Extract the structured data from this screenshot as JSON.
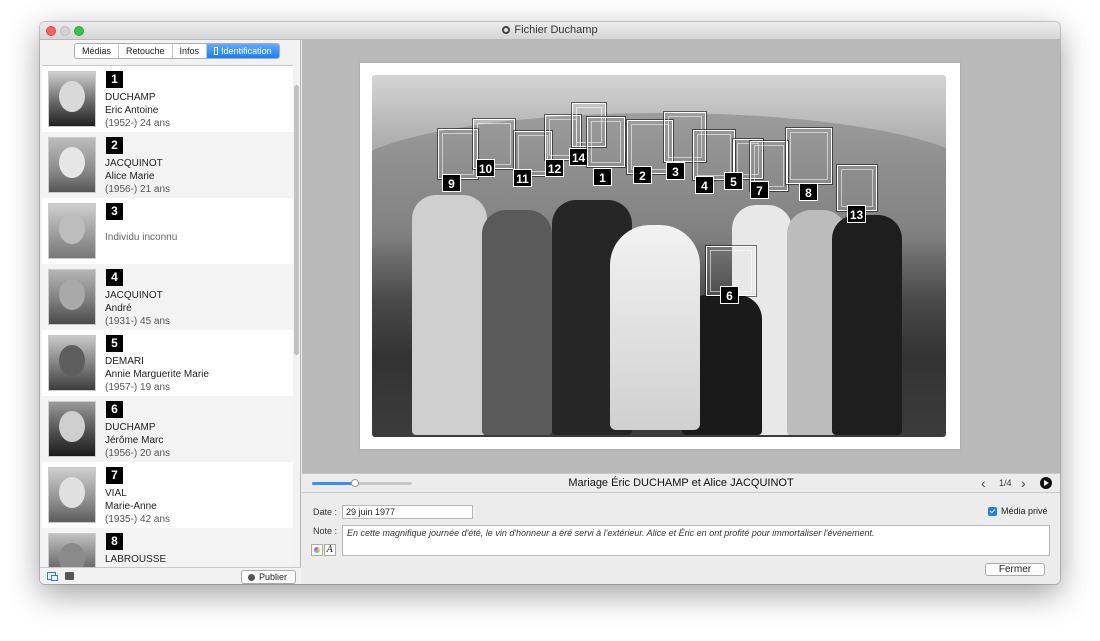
{
  "window": {
    "title": "Fichier Duchamp"
  },
  "sidebar": {
    "tabs": [
      {
        "label": "Médias",
        "active": false
      },
      {
        "label": "Retouche",
        "active": false
      },
      {
        "label": "Infos",
        "active": false
      },
      {
        "label": "Identification",
        "active": true
      }
    ],
    "people": [
      {
        "number": "1",
        "surname": "DUCHAMP",
        "given": "Eric Antoine",
        "age": "(1952-) 24 ans"
      },
      {
        "number": "2",
        "surname": "JACQUINOT",
        "given": "Alice Marie",
        "age": "(1956-) 21 ans"
      },
      {
        "number": "3",
        "unknown": "Individu inconnu"
      },
      {
        "number": "4",
        "surname": "JACQUINOT",
        "given": "André",
        "age": "(1931-) 45 ans"
      },
      {
        "number": "5",
        "surname": "DEMARI",
        "given": "Annie Marguerite Marie",
        "age": "(1957-) 19 ans"
      },
      {
        "number": "6",
        "surname": "DUCHAMP",
        "given": "Jérôme Marc",
        "age": "(1956-) 20 ans"
      },
      {
        "number": "7",
        "surname": "VIAL",
        "given": "Marie-Anne",
        "age": "(1935-) 42 ans"
      },
      {
        "number": "8",
        "surname": "LABROUSSE"
      }
    ],
    "footer": {
      "publish_label": "Publier"
    }
  },
  "viewer": {
    "face_tags": [
      "1",
      "2",
      "3",
      "4",
      "5",
      "6",
      "7",
      "8",
      "9",
      "10",
      "11",
      "12",
      "13",
      "14"
    ],
    "slider_level": 0.43,
    "caption": "Mariage Éric DUCHAMP et Alice JACQUINOT",
    "counter": "1/4"
  },
  "details": {
    "date_label": "Date :",
    "date_value": "29 juin 1977",
    "note_label": "Note :",
    "note_value": "En cette magnifique journée d'été, le vin d'honneur a éré servi à l'extérieur. Alice et Éric en ont profité pour immortaliser l'événement.",
    "private_label": "Média privé",
    "private_checked": true,
    "close_label": "Fermer"
  },
  "colors": {
    "accent": "#1a7ff5",
    "close": "#fc605c",
    "zoom": "#34c84a"
  }
}
